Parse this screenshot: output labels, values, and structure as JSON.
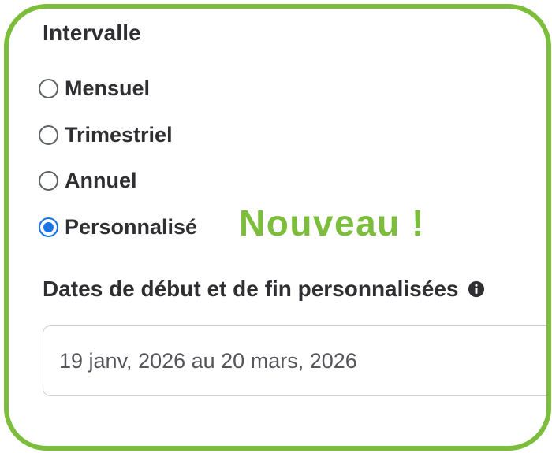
{
  "interval": {
    "title": "Intervalle",
    "options": [
      {
        "label": "Mensuel",
        "checked": false
      },
      {
        "label": "Trimestriel",
        "checked": false
      },
      {
        "label": "Annuel",
        "checked": false
      },
      {
        "label": "Personnalisé",
        "checked": true
      }
    ]
  },
  "badge": {
    "text": "Nouveau !",
    "color": "#7cbd3c"
  },
  "custom_dates": {
    "label": "Dates de début et de fin personnalisées",
    "info_icon": "info-icon",
    "value": "19 janv, 2026 au 20 mars, 2026"
  },
  "colors": {
    "frame": "#7cbd3c",
    "radio_selected": "#1a73e8"
  }
}
